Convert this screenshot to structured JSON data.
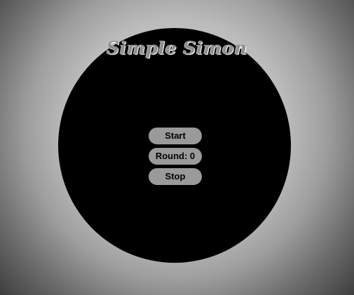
{
  "game": {
    "title": "Simple Simon",
    "start_label": "Start",
    "round_label": "Round: 0",
    "stop_label": "Stop"
  },
  "colors": {
    "board": "#000000",
    "pill": "#9a9a9a",
    "title": "#8f8f8f"
  }
}
